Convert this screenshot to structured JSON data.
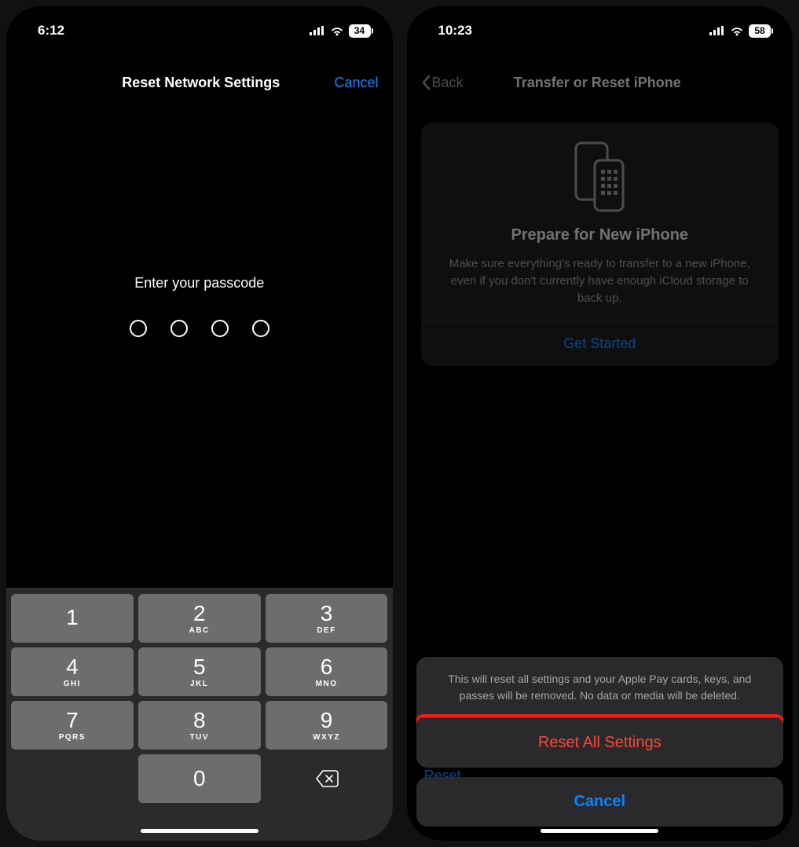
{
  "left": {
    "status": {
      "time": "6:12",
      "battery": "34"
    },
    "nav": {
      "title": "Reset Network Settings",
      "cancel": "Cancel"
    },
    "prompt": "Enter your passcode",
    "keys": [
      {
        "n": "1",
        "l": ""
      },
      {
        "n": "2",
        "l": "ABC"
      },
      {
        "n": "3",
        "l": "DEF"
      },
      {
        "n": "4",
        "l": "GHI"
      },
      {
        "n": "5",
        "l": "JKL"
      },
      {
        "n": "6",
        "l": "MNO"
      },
      {
        "n": "7",
        "l": "PQRS"
      },
      {
        "n": "8",
        "l": "TUV"
      },
      {
        "n": "9",
        "l": "WXYZ"
      }
    ],
    "zero": "0"
  },
  "right": {
    "status": {
      "time": "10:23",
      "battery": "58"
    },
    "nav": {
      "back": "Back",
      "title": "Transfer or Reset iPhone"
    },
    "card": {
      "title": "Prepare for New iPhone",
      "body": "Make sure everything's ready to transfer to a new iPhone, even if you don't currently have enough iCloud storage to back up.",
      "cta": "Get Started"
    },
    "sheet": {
      "message": "This will reset all settings and your Apple Pay cards, keys, and passes will be removed. No data or media will be deleted.",
      "reset": "Reset All Settings",
      "cancel": "Cancel"
    },
    "bg_reset": "Reset"
  }
}
